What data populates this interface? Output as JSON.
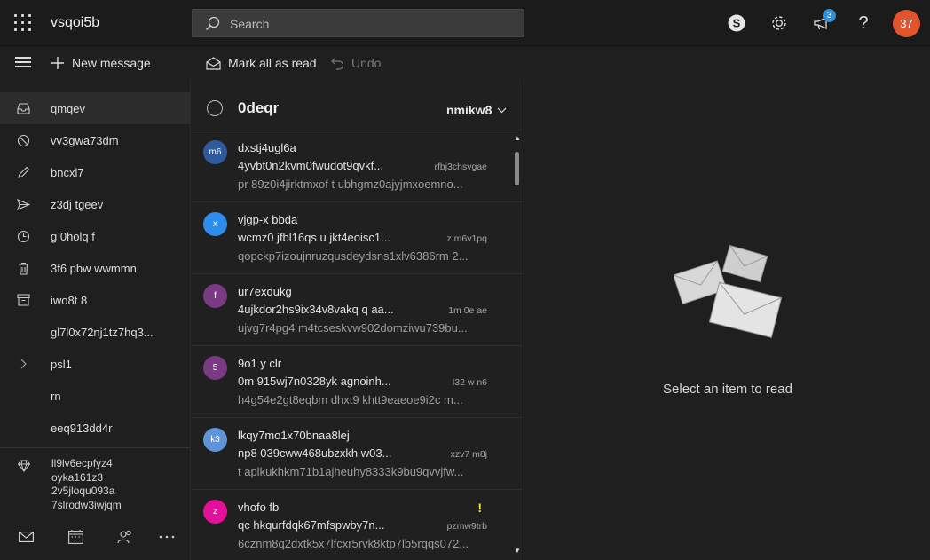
{
  "header": {
    "app_title": "vsqoi5b",
    "search_placeholder": "Search",
    "notification_count": "3",
    "user_initials": "37",
    "help_label": "?"
  },
  "toolbar": {
    "new_message": "New message",
    "mark_all_read": "Mark all as read",
    "undo": "Undo"
  },
  "nav": {
    "items": [
      {
        "label": "qmqev",
        "icon": "inbox-icon"
      },
      {
        "label": "vv3gwa73dm",
        "icon": "junk-icon"
      },
      {
        "label": "bncxl7",
        "icon": "drafts-icon"
      },
      {
        "label": "z3dj tgeev",
        "icon": "sent-icon"
      },
      {
        "label": "g 0holq f",
        "icon": "scheduled-icon"
      },
      {
        "label": "3f6 pbw wwmmn",
        "icon": "trash-icon"
      },
      {
        "label": "iwo8t 8",
        "icon": "archive-icon"
      },
      {
        "label": "gl7l0x72nj1tz7hq3...",
        "icon": ""
      },
      {
        "label": "psl1",
        "icon": "chevron-right-icon"
      },
      {
        "label": "rn",
        "icon": ""
      },
      {
        "label": "eeq913dd4r",
        "icon": ""
      }
    ],
    "promo": {
      "line1": "ll9lv6ecpfyz4",
      "line2": "oyka161z3",
      "line3": "2v5jloqu093a",
      "line4": "7slrodw3iwjqm"
    }
  },
  "list": {
    "folder_title": "0deqr",
    "filter_label": "nmikw8",
    "messages": [
      {
        "initials": "m6",
        "color": "#2e5a9e",
        "from": "dxstj4ugl6a",
        "subject": "4yvbt0n2kvm0fwudot9qvkf...",
        "time": "rfbj3chsvgae",
        "preview": "pr 89z0i4jirktmxof t ubhgmz0ajyjmxoemno...",
        "flag": ""
      },
      {
        "initials": "x",
        "color": "#2f8cec",
        "from": "vjgp-x bbda",
        "subject": "wcmz0 jfbl16qs u jkt4eoisc1...",
        "time": "z m6v1pq",
        "preview": "qopckp7izoujnruzqusdeydsns1xlv6386rm 2...",
        "flag": ""
      },
      {
        "initials": "f",
        "color": "#7a3a84",
        "from": "ur7exdukg",
        "subject": "4ujkdor2hs9ix34v8vakq q aa...",
        "time": "1m 0e ae",
        "preview": "ujvg7r4pg4 m4tcseskvw902domziwu739bu...",
        "flag": ""
      },
      {
        "initials": "5",
        "color": "#7a3a84",
        "from": "9o1 y clr",
        "subject": "0m 915wj7n0328yk agnoinh...",
        "time": "l32 w n6",
        "preview": "h4g54e2gt8eqbm dhxt9 khtt9eaeoe9i2c m...",
        "flag": ""
      },
      {
        "initials": "k3",
        "color": "#5f95d8",
        "from": "lkqy7mo1x70bnaa8lej",
        "subject": "np8 039cww468ubzxkh w03...",
        "time": "xzv7 m8j",
        "preview": "t aplkukhkm71b1ajheuhy8333k9bu9qvvjfw...",
        "flag": ""
      },
      {
        "initials": "z",
        "color": "#e3119a",
        "from": "vhofo fb",
        "subject": "qc hkqurfdqk67mfspwby7n...",
        "time": "pzmw9trb",
        "preview": "6cznm8q2dxtk5x7lfcxr5rvk8ktp7lb5rqqs072...",
        "flag": "!"
      }
    ]
  },
  "reading": {
    "empty_text": "Select an item to read"
  }
}
